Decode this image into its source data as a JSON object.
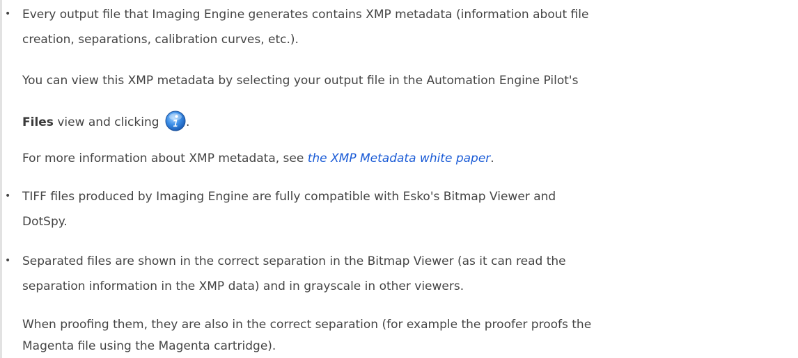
{
  "items": [
    {
      "lines": [
        "Every output file that Imaging Engine generates contains XMP metadata (information about file",
        "creation, separations, calibration curves, etc.)."
      ],
      "notes": {
        "view_text": "You can view this XMP metadata by selecting your output file in the Automation Engine Pilot's",
        "files_bold": "Files",
        "files_suffix": " view and clicking ",
        "files_period": ".",
        "info_icon": "info-icon",
        "more_prefix": "For more information about XMP metadata, see ",
        "more_link": "the XMP Metadata white paper",
        "more_suffix": "."
      }
    },
    {
      "lines": [
        "TIFF files produced by Imaging Engine are fully compatible with Esko's Bitmap Viewer and",
        "DotSpy."
      ]
    },
    {
      "lines": [
        "Separated files are shown in the correct separation in the Bitmap Viewer (as it can read the",
        "separation information in the XMP data) and in grayscale in other viewers."
      ],
      "notes": {
        "proof_line1": "When proofing them, they are also in the correct separation (for example the proofer proofs the",
        "proof_line2": "Magenta file using the Magenta cartridge)."
      }
    }
  ],
  "bullet_char": "•",
  "colors": {
    "text": "#444444",
    "link": "#1a5bd6",
    "icon": "#2f7fe0"
  }
}
